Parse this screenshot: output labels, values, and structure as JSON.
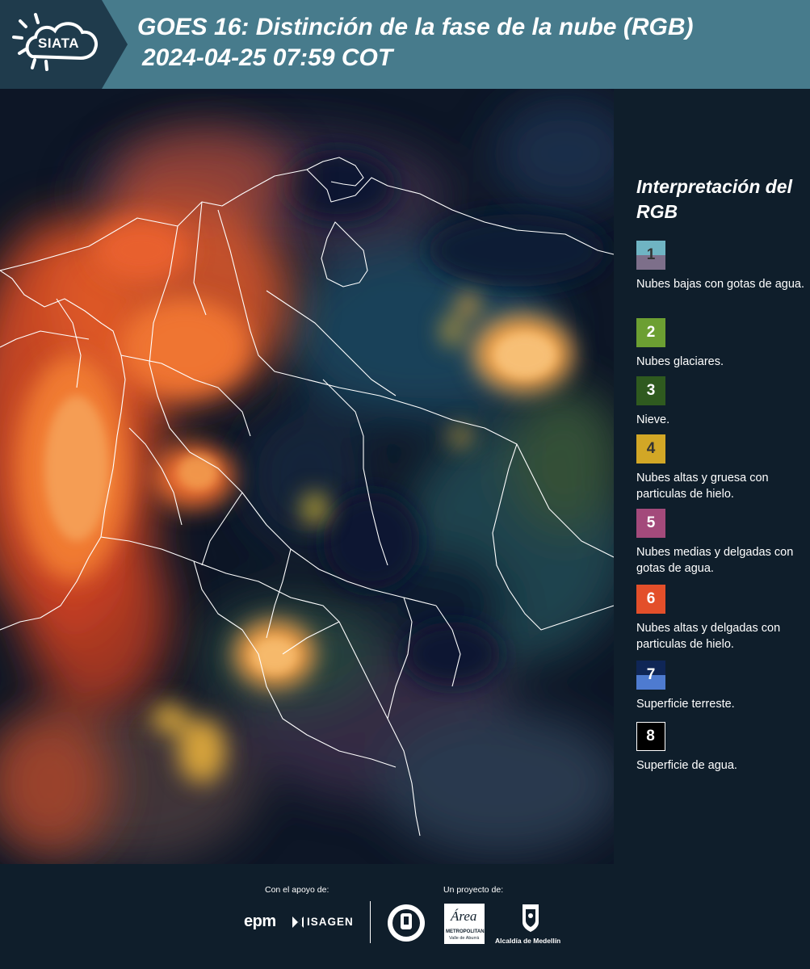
{
  "header": {
    "logo_text": "SIATA",
    "title": "GOES 16: Distinción de la fase de la nube (RGB)",
    "subtitle": "2024-04-25 07:59 COT",
    "background_color": "#477b8c"
  },
  "legend": {
    "title": "Interpretación del RGB",
    "items": [
      {
        "number": "1",
        "label": "Nubes bajas con gotas de agua.",
        "color_top": "#6fb4c3",
        "color_bottom": "#7d6f8a",
        "number_color": "#333333"
      },
      {
        "number": "2",
        "label": "Nubes glaciares.",
        "color_top": "#6c9f32",
        "color_bottom": "#6c9f32",
        "number_color": "#ffffff"
      },
      {
        "number": "3",
        "label": "Nieve.",
        "color_top": "#2f5a1f",
        "color_bottom": "#2f5a1f",
        "number_color": "#ffffff"
      },
      {
        "number": "4",
        "label": "Nubes altas y gruesa con particulas de hielo.",
        "color_top": "#d2a726",
        "color_bottom": "#d2a726",
        "number_color": "#333333"
      },
      {
        "number": "5",
        "label": "Nubes medias y delgadas con gotas de agua.",
        "color_top": "#a34a7b",
        "color_bottom": "#a34a7b",
        "number_color": "#ffffff"
      },
      {
        "number": "6",
        "label": "Nubes altas y delgadas con particulas de hielo.",
        "color_top": "#e34f2a",
        "color_bottom": "#e34f2a",
        "number_color": "#ffffff"
      },
      {
        "number": "7",
        "label": "Superficie terreste.",
        "color_top": "#0f2656",
        "color_bottom": "#4e7bd0",
        "number_color": "#ffffff"
      },
      {
        "number": "8",
        "label": "Superficie de agua.",
        "color_top": "#000000",
        "color_bottom": "#000000",
        "number_color": "#ffffff"
      }
    ]
  },
  "footer": {
    "support_label": "Con el apoyo de:",
    "project_label": "Un proyecto de:",
    "sponsors": [
      "epm",
      "ISAGEN"
    ],
    "partner_area_text": "Área",
    "partner_area_caption": "METROPOLITANA",
    "partner_area_subcaption": "Valle de Aburrá",
    "partner_alcaldia": "Alcaldía de Medellín"
  },
  "colors": {
    "panel_dark": "#0f1e2b",
    "map_background": "#0d1626",
    "cloud_orange": "#f07a30",
    "cloud_yellow": "#f3b95c",
    "border_white": "#ffffff"
  }
}
